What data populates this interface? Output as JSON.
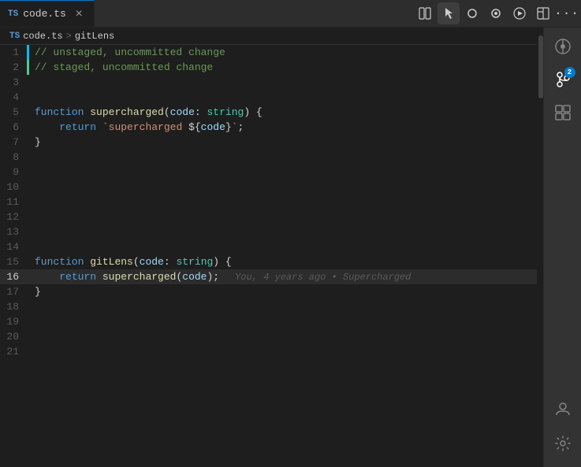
{
  "tab": {
    "icon": "TS",
    "name": "code.ts",
    "close_label": "×"
  },
  "breadcrumb": {
    "file": "code.ts",
    "separator": ">",
    "symbol": "gitLens"
  },
  "toolbar": {
    "icons": [
      {
        "name": "split-editor-icon",
        "symbol": "⊟",
        "title": "Split Editor"
      },
      {
        "name": "cursor-icon",
        "symbol": "↖",
        "title": "Cursor",
        "active": true
      },
      {
        "name": "circle-icon",
        "symbol": "○",
        "title": ""
      },
      {
        "name": "circle-dot-icon",
        "symbol": "⊙",
        "title": ""
      },
      {
        "name": "play-icon",
        "symbol": "▶",
        "title": "Run"
      },
      {
        "name": "layout-icon",
        "symbol": "▥",
        "title": "Layout"
      },
      {
        "name": "more-icon",
        "symbol": "⋯",
        "title": "More"
      }
    ]
  },
  "lines": [
    {
      "num": 1,
      "git": "unstaged",
      "tokens": [
        {
          "t": "comment",
          "v": "// unstaged, uncommitted change"
        }
      ]
    },
    {
      "num": 2,
      "git": "staged",
      "tokens": [
        {
          "t": "comment",
          "v": "// staged, uncommitted change"
        }
      ]
    },
    {
      "num": 3,
      "tokens": []
    },
    {
      "num": 4,
      "tokens": []
    },
    {
      "num": 5,
      "tokens": [
        {
          "t": "kw",
          "v": "function"
        },
        {
          "t": "plain",
          "v": " "
        },
        {
          "t": "fn",
          "v": "supercharged"
        },
        {
          "t": "punct",
          "v": "("
        },
        {
          "t": "param",
          "v": "code"
        },
        {
          "t": "punct",
          "v": ": "
        },
        {
          "t": "type",
          "v": "string"
        },
        {
          "t": "punct",
          "v": ") {"
        }
      ]
    },
    {
      "num": 6,
      "tokens": [
        {
          "t": "plain",
          "v": "    "
        },
        {
          "t": "kw",
          "v": "return"
        },
        {
          "t": "plain",
          "v": " "
        },
        {
          "t": "tmpl",
          "v": "`supercharged "
        },
        {
          "t": "punct",
          "v": "${"
        },
        {
          "t": "param",
          "v": "code"
        },
        {
          "t": "punct",
          "v": "}"
        },
        {
          "t": "tmpl",
          "v": "`"
        },
        {
          "t": "punct",
          "v": ";"
        }
      ]
    },
    {
      "num": 7,
      "tokens": [
        {
          "t": "punct",
          "v": "}"
        }
      ]
    },
    {
      "num": 8,
      "tokens": []
    },
    {
      "num": 9,
      "tokens": []
    },
    {
      "num": 10,
      "tokens": []
    },
    {
      "num": 11,
      "tokens": []
    },
    {
      "num": 12,
      "tokens": []
    },
    {
      "num": 13,
      "tokens": []
    },
    {
      "num": 14,
      "tokens": []
    },
    {
      "num": 15,
      "tokens": [
        {
          "t": "kw",
          "v": "function"
        },
        {
          "t": "plain",
          "v": " "
        },
        {
          "t": "fn",
          "v": "gitLens"
        },
        {
          "t": "punct",
          "v": "("
        },
        {
          "t": "param",
          "v": "code"
        },
        {
          "t": "punct",
          "v": ": "
        },
        {
          "t": "type",
          "v": "string"
        },
        {
          "t": "punct",
          "v": ") {"
        }
      ]
    },
    {
      "num": 16,
      "active": true,
      "tokens": [
        {
          "t": "plain",
          "v": "    "
        },
        {
          "t": "kw",
          "v": "return"
        },
        {
          "t": "plain",
          "v": " "
        },
        {
          "t": "fn",
          "v": "supercharged"
        },
        {
          "t": "punct",
          "v": "("
        },
        {
          "t": "param",
          "v": "code"
        },
        {
          "t": "punct",
          "v": ");"
        }
      ],
      "blame": "You, 4 years ago • Supercharged"
    },
    {
      "num": 17,
      "tokens": [
        {
          "t": "punct",
          "v": "}"
        }
      ]
    },
    {
      "num": 18,
      "tokens": []
    },
    {
      "num": 19,
      "tokens": []
    },
    {
      "num": 20,
      "tokens": []
    },
    {
      "num": 21,
      "tokens": []
    }
  ],
  "activity": {
    "icons": [
      {
        "name": "gitlens-icon",
        "symbol": "⟐",
        "title": "GitLens"
      },
      {
        "name": "source-control-icon",
        "symbol": "⌥",
        "title": "Source Control",
        "badge": "2"
      },
      {
        "name": "extensions-icon",
        "symbol": "⊞",
        "title": "Extensions"
      }
    ],
    "bottom": [
      {
        "name": "account-icon",
        "symbol": "👤",
        "title": "Account"
      },
      {
        "name": "settings-icon",
        "symbol": "⚙",
        "title": "Settings"
      }
    ]
  }
}
